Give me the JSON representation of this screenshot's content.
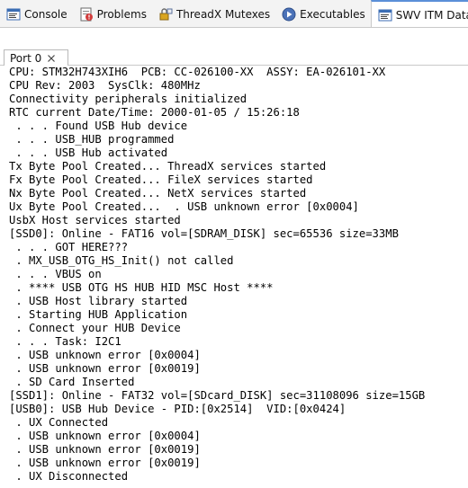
{
  "view_tabs": [
    {
      "label": "Console",
      "icon": "console-icon"
    },
    {
      "label": "Problems",
      "icon": "problems-icon"
    },
    {
      "label": "ThreadX Mutexes",
      "icon": "mutex-icon"
    },
    {
      "label": "Executables",
      "icon": "executables-icon"
    },
    {
      "label": "SWV ITM Data Console",
      "icon": "itm-console-icon",
      "active": true
    }
  ],
  "console_tab": {
    "label": "Port 0"
  },
  "colors": {
    "tab_accent": "#5b8fd8",
    "console_text": "#000000",
    "tabbar_bg": "#f3f3f3"
  },
  "console_lines": [
    "CPU: STM32H743XIH6  PCB: CC-026100-XX  ASSY: EA-026101-XX",
    "CPU Rev: 2003  SysClk: 480MHz",
    "Connectivity peripherals initialized",
    "RTC current Date/Time: 2000-01-05 / 15:26:18",
    " . . . Found USB Hub device",
    " . . . USB_HUB programmed",
    " . . . USB Hub activated",
    "Tx Byte Pool Created... ThreadX services started",
    "Fx Byte Pool Created... FileX services started",
    "Nx Byte Pool Created... NetX services started",
    "Ux Byte Pool Created...  . USB unknown error [0x0004]",
    "UsbX Host services started",
    "[SSD0]: Online - FAT16 vol=[SDRAM_DISK] sec=65536 size=33MB",
    " . . . GOT HERE???",
    " . MX_USB_OTG_HS_Init() not called",
    " . . . VBUS on",
    " . **** USB OTG HS HUB HID MSC Host ****",
    " . USB Host library started",
    " . Starting HUB Application",
    " . Connect your HUB Device",
    " . . . Task: I2C1",
    " . USB unknown error [0x0004]",
    " . USB unknown error [0x0019]",
    " . SD Card Inserted",
    "[SSD1]: Online - FAT32 vol=[SDcard_DISK] sec=31108096 size=15GB",
    "[USB0]: USB Hub Device - PID:[0x2514]  VID:[0x0424]",
    " . UX Connected",
    " . USB unknown error [0x0004]",
    " . USB unknown error [0x0019]",
    " . USB unknown error [0x0019]",
    " . UX Disconnected"
  ]
}
